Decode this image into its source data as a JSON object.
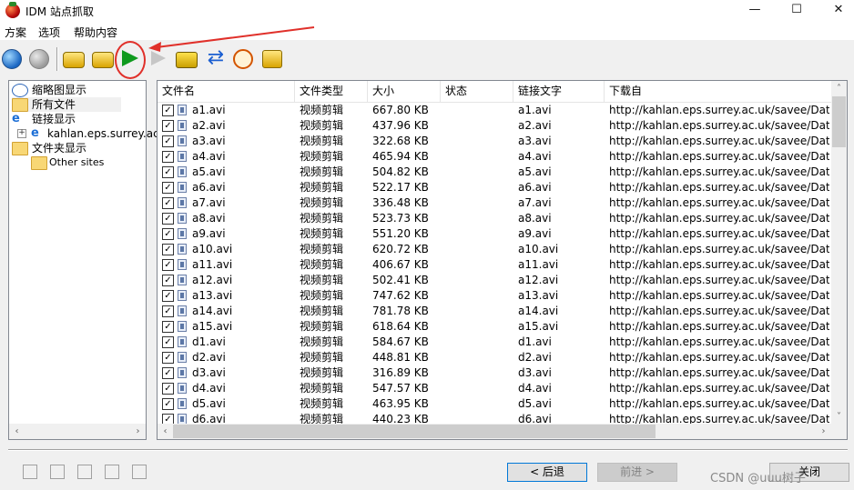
{
  "window": {
    "title": "IDM 站点抓取",
    "minimize": "—",
    "maximize": "☐",
    "close": "✕"
  },
  "menu": [
    "方案",
    "选项",
    "帮助内容"
  ],
  "toolbar_icons": [
    "globe-icon",
    "globe-disabled-icon",
    "binoculars-icon",
    "binoculars-2-icon",
    "start-play-icon",
    "stop-play-icon",
    "stack-icon",
    "refresh-icon",
    "alarm-clock-icon",
    "grab-icon"
  ],
  "tree": {
    "items": [
      "缩略图显示",
      "所有文件",
      "链接显示",
      "kahlan.eps.surrey.ac.",
      "文件夹显示",
      "Other sites"
    ]
  },
  "list": {
    "columns": [
      "文件名",
      "文件类型",
      "大小",
      "状态",
      "链接文字",
      "下载自"
    ],
    "rows": [
      {
        "name": "a1.avi",
        "type": "视频剪辑",
        "size": "667.80  KB",
        "status": "",
        "link": "a1.avi",
        "from": "http://kahlan.eps.surrey.ac.uk/savee/Data/Au..."
      },
      {
        "name": "a2.avi",
        "type": "视频剪辑",
        "size": "437.96  KB",
        "status": "",
        "link": "a2.avi",
        "from": "http://kahlan.eps.surrey.ac.uk/savee/Data/Au..."
      },
      {
        "name": "a3.avi",
        "type": "视频剪辑",
        "size": "322.68  KB",
        "status": "",
        "link": "a3.avi",
        "from": "http://kahlan.eps.surrey.ac.uk/savee/Data/Au..."
      },
      {
        "name": "a4.avi",
        "type": "视频剪辑",
        "size": "465.94  KB",
        "status": "",
        "link": "a4.avi",
        "from": "http://kahlan.eps.surrey.ac.uk/savee/Data/Au..."
      },
      {
        "name": "a5.avi",
        "type": "视频剪辑",
        "size": "504.82  KB",
        "status": "",
        "link": "a5.avi",
        "from": "http://kahlan.eps.surrey.ac.uk/savee/Data/Au..."
      },
      {
        "name": "a6.avi",
        "type": "视频剪辑",
        "size": "522.17  KB",
        "status": "",
        "link": "a6.avi",
        "from": "http://kahlan.eps.surrey.ac.uk/savee/Data/Au..."
      },
      {
        "name": "a7.avi",
        "type": "视频剪辑",
        "size": "336.48  KB",
        "status": "",
        "link": "a7.avi",
        "from": "http://kahlan.eps.surrey.ac.uk/savee/Data/Au..."
      },
      {
        "name": "a8.avi",
        "type": "视频剪辑",
        "size": "523.73  KB",
        "status": "",
        "link": "a8.avi",
        "from": "http://kahlan.eps.surrey.ac.uk/savee/Data/Au..."
      },
      {
        "name": "a9.avi",
        "type": "视频剪辑",
        "size": "551.20  KB",
        "status": "",
        "link": "a9.avi",
        "from": "http://kahlan.eps.surrey.ac.uk/savee/Data/Au..."
      },
      {
        "name": "a10.avi",
        "type": "视频剪辑",
        "size": "620.72  KB",
        "status": "",
        "link": "a10.avi",
        "from": "http://kahlan.eps.surrey.ac.uk/savee/Data/Au..."
      },
      {
        "name": "a11.avi",
        "type": "视频剪辑",
        "size": "406.67  KB",
        "status": "",
        "link": "a11.avi",
        "from": "http://kahlan.eps.surrey.ac.uk/savee/Data/Au..."
      },
      {
        "name": "a12.avi",
        "type": "视频剪辑",
        "size": "502.41  KB",
        "status": "",
        "link": "a12.avi",
        "from": "http://kahlan.eps.surrey.ac.uk/savee/Data/Au..."
      },
      {
        "name": "a13.avi",
        "type": "视频剪辑",
        "size": "747.62  KB",
        "status": "",
        "link": "a13.avi",
        "from": "http://kahlan.eps.surrey.ac.uk/savee/Data/Au..."
      },
      {
        "name": "a14.avi",
        "type": "视频剪辑",
        "size": "781.78  KB",
        "status": "",
        "link": "a14.avi",
        "from": "http://kahlan.eps.surrey.ac.uk/savee/Data/Au..."
      },
      {
        "name": "a15.avi",
        "type": "视频剪辑",
        "size": "618.64  KB",
        "status": "",
        "link": "a15.avi",
        "from": "http://kahlan.eps.surrey.ac.uk/savee/Data/Au..."
      },
      {
        "name": "d1.avi",
        "type": "视频剪辑",
        "size": "584.67  KB",
        "status": "",
        "link": "d1.avi",
        "from": "http://kahlan.eps.surrey.ac.uk/savee/Data/Au..."
      },
      {
        "name": "d2.avi",
        "type": "视频剪辑",
        "size": "448.81  KB",
        "status": "",
        "link": "d2.avi",
        "from": "http://kahlan.eps.surrey.ac.uk/savee/Data/Au..."
      },
      {
        "name": "d3.avi",
        "type": "视频剪辑",
        "size": "316.89  KB",
        "status": "",
        "link": "d3.avi",
        "from": "http://kahlan.eps.surrey.ac.uk/savee/Data/Au..."
      },
      {
        "name": "d4.avi",
        "type": "视频剪辑",
        "size": "547.57  KB",
        "status": "",
        "link": "d4.avi",
        "from": "http://kahlan.eps.surrey.ac.uk/savee/Data/Au..."
      },
      {
        "name": "d5.avi",
        "type": "视频剪辑",
        "size": "463.95  KB",
        "status": "",
        "link": "d5.avi",
        "from": "http://kahlan.eps.surrey.ac.uk/savee/Data/Au..."
      },
      {
        "name": "d6.avi",
        "type": "视频剪辑",
        "size": "440.23  KB",
        "status": "",
        "link": "d6.avi",
        "from": "http://kahlan.eps.surrey.ac.uk/savee/Data/Au..."
      }
    ]
  },
  "buttons": {
    "back": "< 后退",
    "next": "前进 >",
    "close": "关闭"
  },
  "watermark": "CSDN @uuu树子",
  "colors": {
    "annotation_red": "#e0302a",
    "play_green": "#0f9a1e",
    "focus_blue": "#0078d7"
  }
}
